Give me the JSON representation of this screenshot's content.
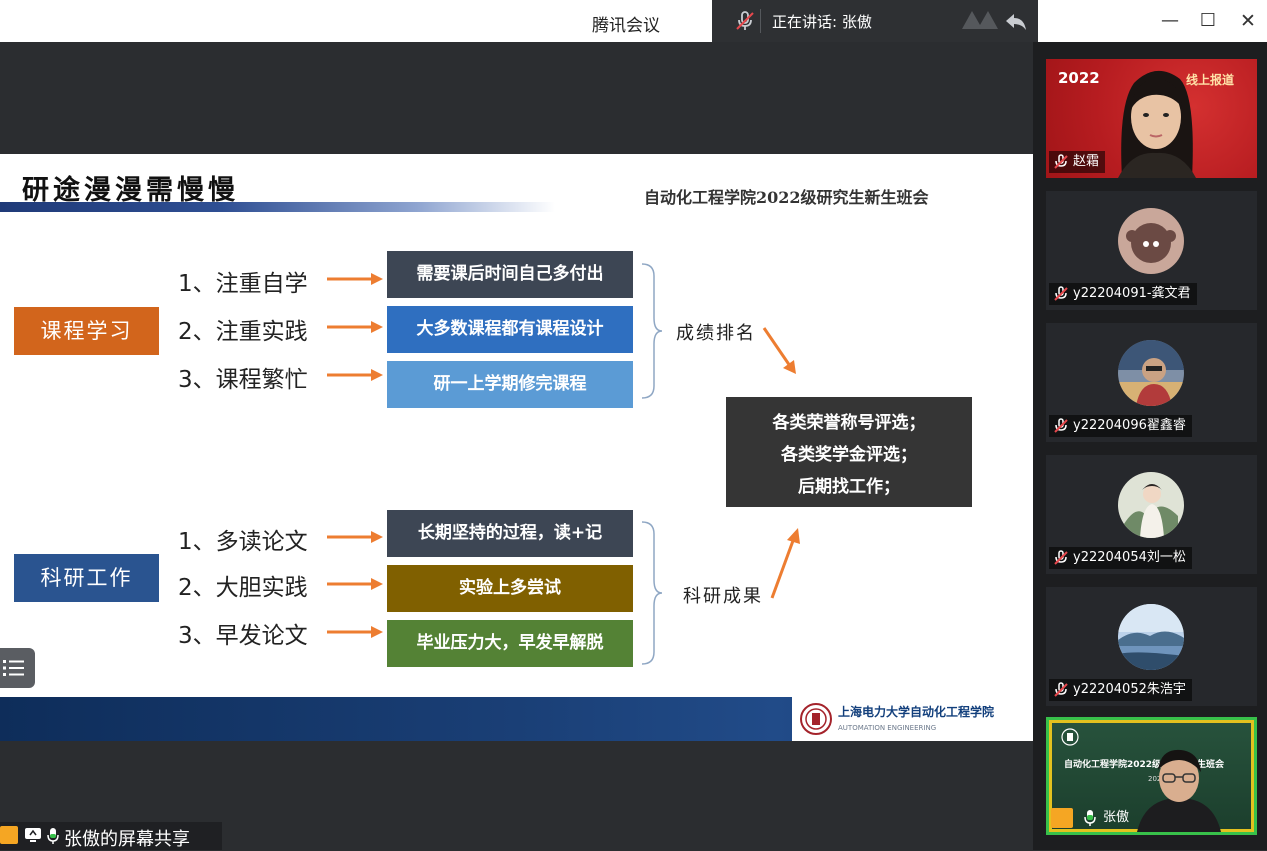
{
  "window": {
    "app_title": "腾讯会议",
    "speaking_text": "正在讲话: 张傲",
    "controls": {
      "minimize": "—",
      "maximize": "☐",
      "close": "✕"
    }
  },
  "slide": {
    "title": "研途漫漫需慢慢",
    "subtitle": "自动化工程学院2022级研究生新生班会",
    "course": {
      "label": "课程学习",
      "points": [
        "1、注重自学",
        "2、注重实践",
        "3、课程繁忙"
      ],
      "boxes": [
        "需要课后时间自己多付出",
        "大多数课程都有课程设计",
        "研一上学期修完课程"
      ],
      "result": "成绩排名"
    },
    "research": {
      "label": "科研工作",
      "points": [
        "1、多读论文",
        "2、大胆实践",
        "3、早发论文"
      ],
      "boxes": [
        "长期坚持的过程，读+记",
        "实验上多尝试",
        "毕业压力大，早发早解脱"
      ],
      "result": "科研成果"
    },
    "outcome": [
      "各类荣誉称号评选；",
      "各类奖学金评选；",
      "后期找工作；"
    ],
    "footer": {
      "school_name": "上海电力大学自动化工程学院",
      "school_en": "AUTOMATION ENGINEERING"
    }
  },
  "share_label": "张傲的屏幕共享",
  "participants": [
    {
      "name": "赵霜",
      "banner_left": "2022",
      "banner_right": "线上报道"
    },
    {
      "name": "y22204091-龚文君"
    },
    {
      "name": "y22204096翟鑫睿"
    },
    {
      "name": "y22204054刘一松"
    },
    {
      "name": "y22204052朱浩宇"
    },
    {
      "name": "张傲",
      "screen_title": "自动化工程学院2022级研究生新生班会",
      "screen_year": "2022"
    }
  ],
  "colors": {
    "accent_orange": "#d2651c",
    "accent_blue": "#2a5490",
    "active_speaker_border": "#38c14a"
  }
}
